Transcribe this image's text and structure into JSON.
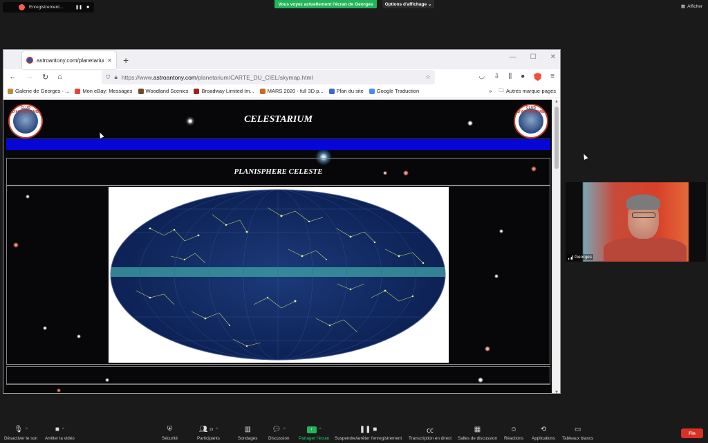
{
  "zoom_top": {
    "recording_label": "Enregistrement...",
    "share_banner": "Vous voyez actuellement l'écran de Georges",
    "view_options": "Options d'affichage",
    "view_button": "Afficher"
  },
  "browser": {
    "tab_title": "astroantony.com/planetarium/C",
    "url_prefix": "https://www.",
    "url_domain": "astroantony.com",
    "url_path": "/planetarium/CARTE_DU_CIEL/skymap.html",
    "bookmarks": [
      {
        "label": "Galerie de Georges - ...",
        "color": "#c08a3a"
      },
      {
        "label": "Mon eBay: Messages",
        "color": "#e5433a"
      },
      {
        "label": "Woodland Scenics",
        "color": "#6b4b2a"
      },
      {
        "label": "Broadway Limited Im...",
        "color": "#a02020"
      },
      {
        "label": "MARS 2020 - full 3D p...",
        "color": "#c86a2a"
      },
      {
        "label": "Plan du site",
        "color": "#3a6ac8"
      },
      {
        "label": "Google Traduction",
        "color": "#4a8af4"
      }
    ],
    "other_bookmarks": "Autres marque-pages"
  },
  "page": {
    "site_title": "CELESTARIUM",
    "section_title": "PLANISPHERE CELESTE",
    "logo_text": "CLUB D'ASTRONOMIE"
  },
  "participant": {
    "name": "Georges"
  },
  "zoom_toolbar": {
    "mute": "Désactiver le son",
    "video": "Arrêter la vidéo",
    "security": "Sécurité",
    "participants": "Participants",
    "participants_count": "19",
    "polls": "Sondages",
    "chat": "Discussion",
    "share": "Partager l'écran",
    "pause": "Suspendre/arrêter l'enregistrement",
    "transcript": "Transcription en direct",
    "breakout": "Salles de discussion",
    "reactions": "Réactions",
    "apps": "Applications",
    "whiteboards": "Tableaux blancs",
    "end": "Fin"
  },
  "colors": {
    "share_green": "#23b35a",
    "end_red": "#d93025",
    "banner_blue": "#0606d9"
  }
}
